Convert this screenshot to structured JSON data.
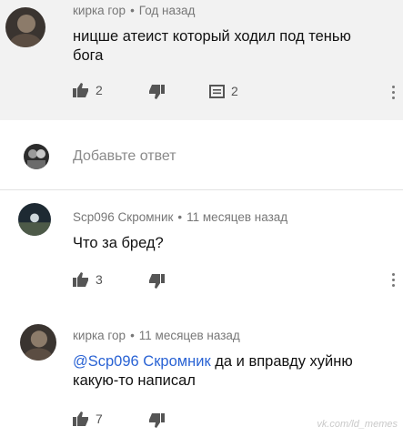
{
  "comments": [
    {
      "author": "кирка гор",
      "time": "Год назад",
      "text": "ницше атеист который ходил под тенью бога",
      "likes": "2",
      "replies": "2"
    },
    {
      "author": "Scp096 Скромник",
      "time": "11 месяцев назад",
      "text": "Что за бред?",
      "likes": "3"
    },
    {
      "author": "кирка гор",
      "time": "11 месяцев назад",
      "mention": "@Scp096 Скромник",
      "text": " да и вправду  хуйню какую-то  написал",
      "likes": "7"
    }
  ],
  "reply_box": {
    "placeholder": "Добавьте ответ"
  },
  "watermark": "vk.com/ld_memes",
  "icons": {
    "like": "thumbs-up-icon",
    "dislike": "thumbs-down-icon",
    "reply": "comment-icon",
    "more": "more-vertical-icon"
  },
  "colors": {
    "mention": "#2a63d4",
    "highlight": "#f2f2f2"
  }
}
